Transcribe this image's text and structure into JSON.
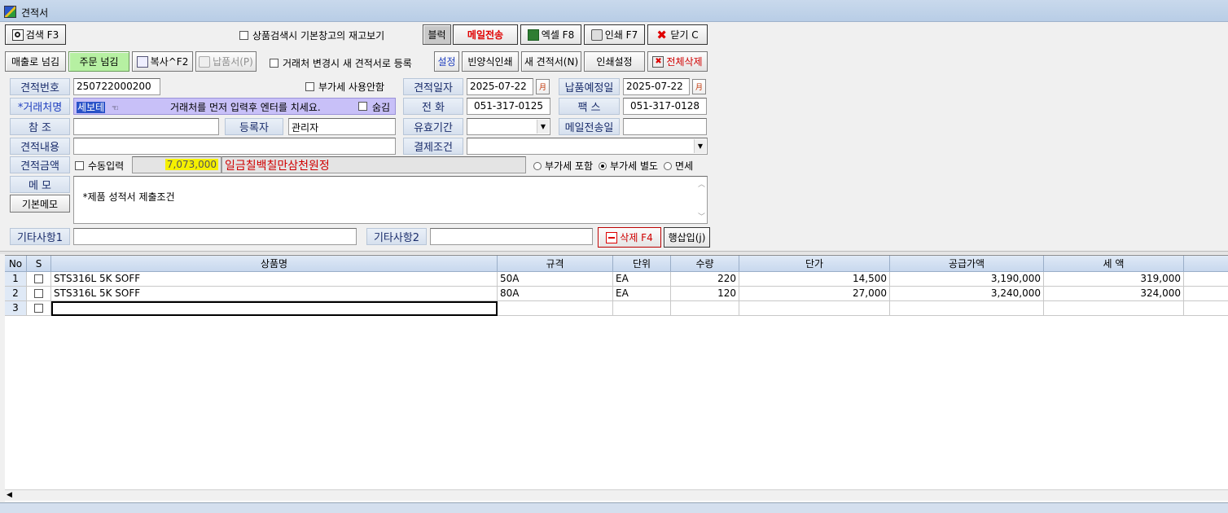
{
  "window": {
    "title": "견적서"
  },
  "toolbar1": {
    "search": "검색 F3",
    "stock_check": "상품검색시 기본창고의 재고보기",
    "block": "블럭",
    "email_send": "메일전송",
    "excel": "엑셀 F8",
    "print": "인쇄 F7",
    "close": "닫기 C"
  },
  "toolbar2": {
    "to_sales": "매출로 넘김",
    "to_order": "주문 넘김",
    "copy": "복사^F2",
    "delivery": "납품서(P)",
    "new_on_change": "거래처 변경시 새 견적서로 등록",
    "settings": "설정",
    "blank_print": "빈양식인쇄",
    "new_quote": "새 견적서(N)",
    "print_settings": "인쇄설정",
    "delete_all": "전체삭제"
  },
  "form": {
    "quote_no_label": "견적번호",
    "quote_no": "250722000200",
    "vat_unused": "부가세 사용안함",
    "quote_date_label": "견적일자",
    "quote_date": "2025-07-22",
    "due_date_label": "납품예정일",
    "due_date": "2025-07-22",
    "calendar_mark": "月",
    "client_label": "*거래처명",
    "client_value": "세보테",
    "client_hint": "거래처를 먼저 입력후 엔터를 치세요.",
    "hide": "숨김",
    "phone_label": "전 화",
    "phone": "051-317-0125",
    "fax_label": "팩 스",
    "fax": "051-317-0128",
    "ref_label": "참 조",
    "ref": "",
    "registrant_label": "등록자",
    "registrant": "관리자",
    "validity_label": "유효기간",
    "email_sent_label": "메일전송일",
    "content_label": "견적내용",
    "payment_label": "결제조건",
    "amount_label": "견적금액",
    "manual_input": "수동입력",
    "amount": "7,073,000",
    "amount_korean": "일금칠백칠만삼천원정",
    "vat_incl": "부가세 포함",
    "vat_excl": "부가세 별도",
    "tax_free": "면세",
    "memo_label": "메 모",
    "basic_memo": "기본메모",
    "memo": "*제품 성적서 제출조건",
    "etc1_label": "기타사항1",
    "etc2_label": "기타사항2",
    "delete_row": "삭제 F4",
    "insert_row": "행삽입(j)"
  },
  "table": {
    "headers": [
      "No",
      "S",
      "상품명",
      "규격",
      "단위",
      "수량",
      "단가",
      "공급가액",
      "세 액"
    ],
    "rows": [
      {
        "no": "1",
        "name": "STS316L 5K SOFF",
        "spec": "50A",
        "unit": "EA",
        "qty": "220",
        "price": "14,500",
        "supply": "3,190,000",
        "tax": "319,000"
      },
      {
        "no": "2",
        "name": "STS316L 5K SOFF",
        "spec": "80A",
        "unit": "EA",
        "qty": "120",
        "price": "27,000",
        "supply": "3,240,000",
        "tax": "324,000"
      },
      {
        "no": "3",
        "name": "",
        "spec": "",
        "unit": "",
        "qty": "",
        "price": "",
        "supply": "",
        "tax": ""
      }
    ]
  }
}
